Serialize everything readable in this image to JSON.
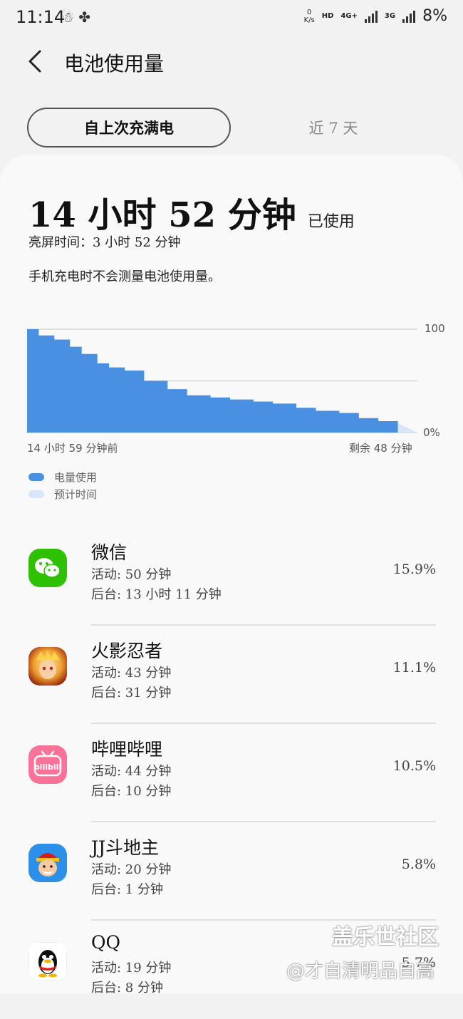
{
  "status_bar": {
    "time": "11:14",
    "speed_value": "0",
    "speed_unit": "K/s",
    "hd": "HD",
    "net_4g": "4G+",
    "net_3g": "3G",
    "battery": "8%",
    "icons": [
      "notification-icon",
      "maple-leaf-icon",
      "signal-icon",
      "signal-icon"
    ]
  },
  "header": {
    "back_icon": "chevron-left-icon",
    "title": "电池使用量"
  },
  "tabs": [
    {
      "label": "自上次充满电",
      "active": true
    },
    {
      "label": "近 7 天",
      "active": false
    }
  ],
  "summary": {
    "used_time": "14 小时 52 分钟",
    "used_suffix": "已使用",
    "screen_time": "亮屏时间：3 小时 52 分钟",
    "note": "手机充电时不会测量电池使用量。"
  },
  "chart_data": {
    "type": "area",
    "x_start_label": "14 小时 59 分钟前",
    "x_end_label": "剩余 48 分钟",
    "y_top_label": "100",
    "y_bottom_label": "0%",
    "ylim": [
      0,
      100
    ],
    "xlim": [
      0,
      1
    ],
    "x": [
      0,
      0.03,
      0.07,
      0.11,
      0.14,
      0.18,
      0.21,
      0.25,
      0.3,
      0.36,
      0.41,
      0.47,
      0.52,
      0.58,
      0.63,
      0.69,
      0.74,
      0.8,
      0.85,
      0.9,
      0.95
    ],
    "values": [
      100,
      94,
      90,
      83,
      76,
      67,
      63,
      60,
      50,
      42,
      36,
      34,
      32,
      30,
      28,
      24,
      21,
      19,
      14,
      11,
      9
    ],
    "forecast_x": [
      0.95,
      1.0
    ],
    "forecast_values": [
      9,
      0
    ],
    "colors": {
      "usage": "#4a90e2",
      "forecast": "#d8e6f8"
    },
    "grid": true
  },
  "legend": [
    {
      "label": "电量使用",
      "color": "#4a90e2"
    },
    {
      "label": "预计时间",
      "color": "#d8e6f8"
    }
  ],
  "apps": [
    {
      "name": "微信",
      "active": "活动: 50 分钟",
      "background": "后台: 13 小时 11 分钟",
      "percent": "15.9%",
      "icon": "wechat-icon"
    },
    {
      "name": "火影忍者",
      "active": "活动: 43 分钟",
      "background": "后台: 31 分钟",
      "percent": "11.1%",
      "icon": "naruto-game-icon"
    },
    {
      "name": "哔哩哔哩",
      "active": "活动: 44 分钟",
      "background": "后台: 10 分钟",
      "percent": "10.5%",
      "icon": "bilibili-icon"
    },
    {
      "name": "JJ斗地主",
      "active": "活动: 20 分钟",
      "background": "后台: 1 分钟",
      "percent": "5.8%",
      "icon": "jj-doudizhu-icon"
    },
    {
      "name": "QQ",
      "active": "活动: 19 分钟",
      "background": "后台: 8 分钟",
      "percent": "5.7%",
      "icon": "qq-icon"
    }
  ],
  "watermark": {
    "line1": "盖乐世社区",
    "line2": "@才自清明品自高"
  }
}
